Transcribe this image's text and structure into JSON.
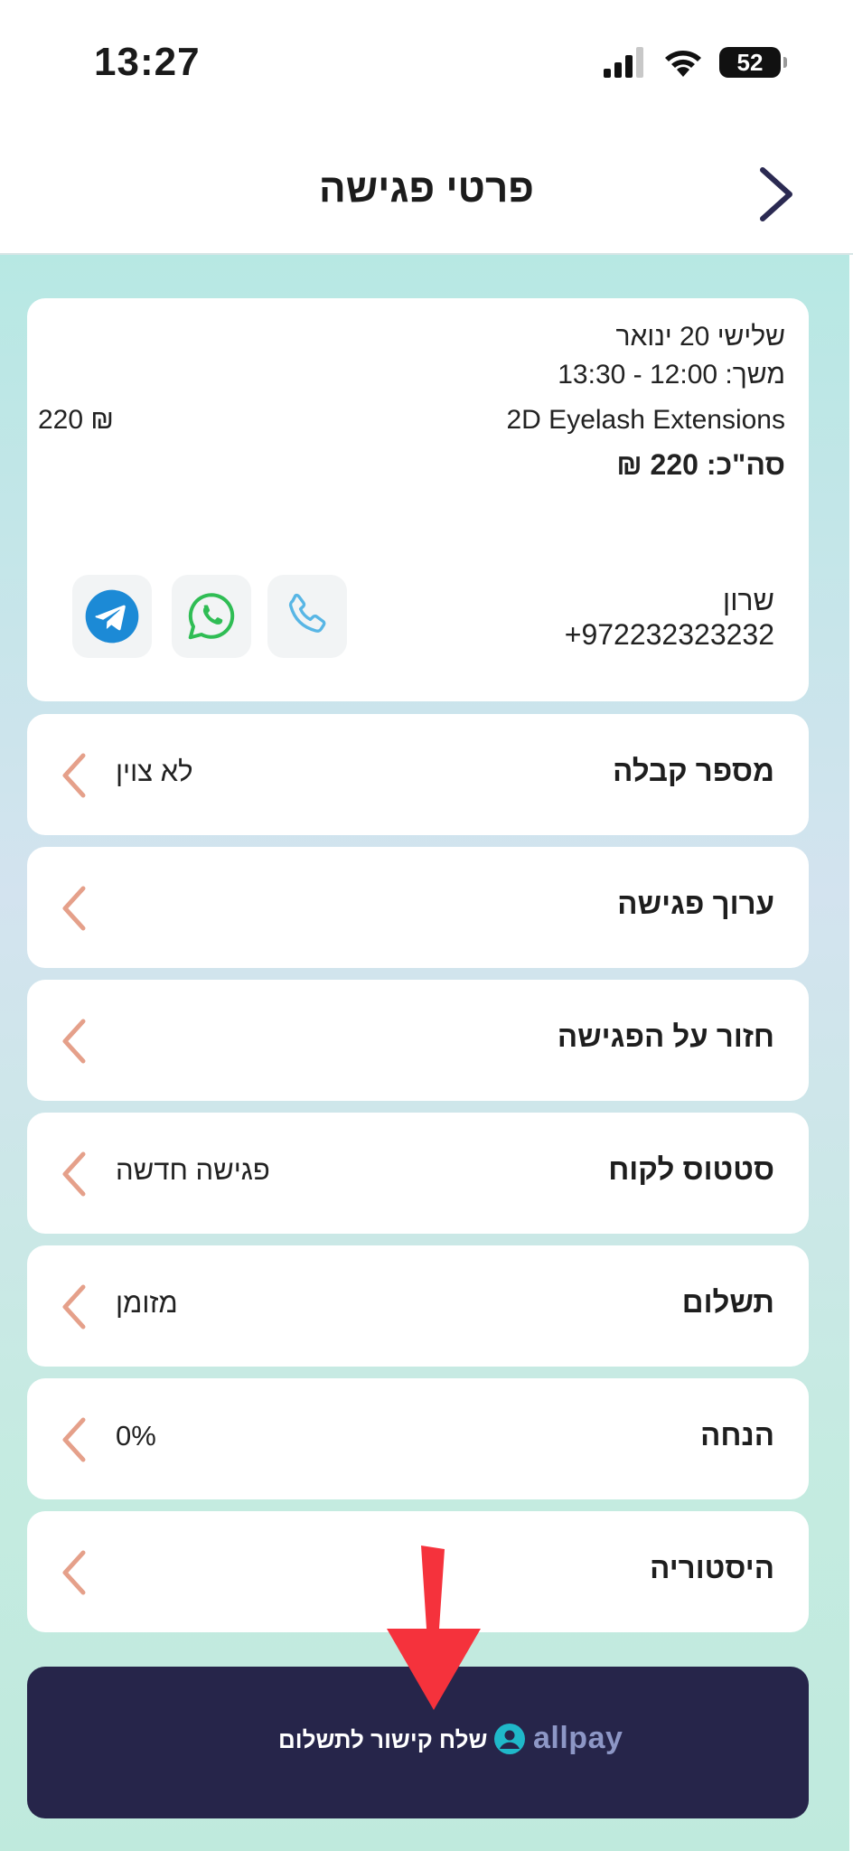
{
  "status_bar": {
    "time": "13:27",
    "battery": "52"
  },
  "header": {
    "title": "פרטי פגישה"
  },
  "appointment": {
    "date": "שלישי 20 ינואר",
    "time_range": "משך: 12:00 - 13:30",
    "service": "2D Eyelash Extensions",
    "price": "220 ₪",
    "total": "סה\"כ: 220 ₪",
    "client_name": "שרון",
    "client_phone": "+972232323232"
  },
  "rows": [
    {
      "label": "מספר קבלה",
      "value": "לא צוין"
    },
    {
      "label": "ערוך פגישה",
      "value": ""
    },
    {
      "label": "חזור על הפגישה",
      "value": ""
    },
    {
      "label": "סטטוס לקוח",
      "value": "פגישה חדשה"
    },
    {
      "label": "תשלום",
      "value": "מזומן"
    },
    {
      "label": "הנחה",
      "value": "0%"
    },
    {
      "label": "היסטוריה",
      "value": ""
    }
  ],
  "pay_button": {
    "brand": "allpay",
    "label": "שלח קישור לתשלום"
  },
  "colors": {
    "accent": "#26254a",
    "chevron": "#e5a08a",
    "phone_icon": "#58b6e5",
    "whatsapp": "#2fbd54",
    "telegram": "#1c8ad6",
    "annotation_arrow": "#f5323c"
  },
  "icons": [
    "chevron-right-icon",
    "phone-icon",
    "whatsapp-icon",
    "telegram-icon",
    "chevron-left-icon",
    "allpay-logo-icon"
  ]
}
